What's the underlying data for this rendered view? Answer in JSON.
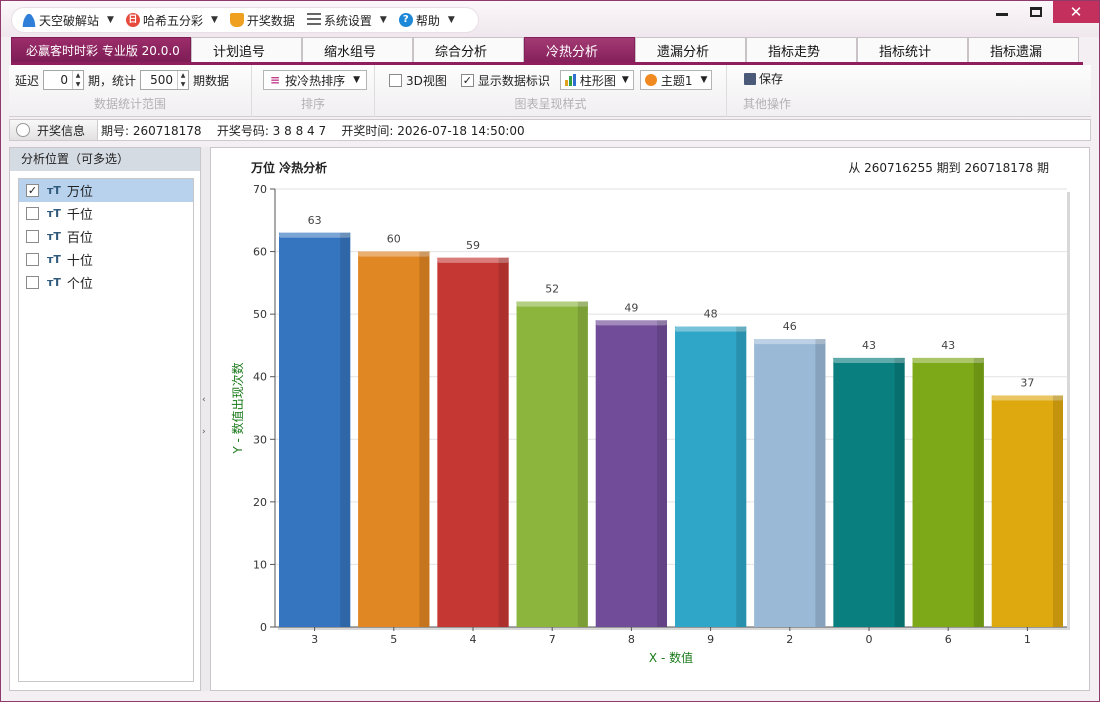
{
  "menu": {
    "items": [
      {
        "label": "天空破解站",
        "icon": "user-icon"
      },
      {
        "label": "哈希五分彩",
        "icon": "hash-icon"
      },
      {
        "label": "开奖数据",
        "icon": "trophy-icon"
      },
      {
        "label": "系统设置",
        "icon": "settings-icon"
      },
      {
        "label": "帮助",
        "icon": "help-icon"
      }
    ]
  },
  "window": {
    "close_symbol": "✕"
  },
  "tabs": {
    "brand": "必赢客时时彩 专业版 20.0.0",
    "items": [
      "计划追号",
      "缩水组号",
      "综合分析",
      "冷热分析",
      "遗漏分析",
      "指标走势",
      "指标统计",
      "指标遗漏"
    ],
    "active": "冷热分析"
  },
  "ribbon": {
    "delay_label": "延迟",
    "delay_value": "0",
    "period_label": "期，统计",
    "count_value": "500",
    "count_suffix": "期数据",
    "group1_label": "数据统计范围",
    "sort_button": "按冷热排序",
    "group2_label": "排序",
    "view3d_label": "3D视图",
    "view3d_checked": false,
    "show_labels_label": "显示数据标识",
    "show_labels_checked": true,
    "chart_type": "柱形图",
    "theme": "主题1",
    "group3_label": "图表呈现样式",
    "save_label": "保存",
    "group4_label": "其他操作"
  },
  "info": {
    "button_label": "开奖信息",
    "text": "期号: 260718178    开奖号码: 3 8 8 4 7    开奖时间: 2026-07-18 14:50:00"
  },
  "left_panel": {
    "title": "分析位置（可多选）",
    "items": [
      {
        "label": "万位",
        "checked": true
      },
      {
        "label": "千位",
        "checked": false
      },
      {
        "label": "百位",
        "checked": false
      },
      {
        "label": "十位",
        "checked": false
      },
      {
        "label": "个位",
        "checked": false
      }
    ]
  },
  "chart": {
    "title": "万位 冷热分析",
    "range_text": "从 260716255 期到 260718178 期"
  },
  "chart_data": {
    "type": "bar",
    "title": "万位 冷热分析",
    "xlabel": "X - 数值",
    "ylabel": "Y - 数值出现次数",
    "categories": [
      "3",
      "5",
      "4",
      "7",
      "8",
      "9",
      "2",
      "0",
      "6",
      "1"
    ],
    "values": [
      63,
      60,
      59,
      52,
      49,
      48,
      46,
      43,
      43,
      37
    ],
    "ylim": [
      0,
      70
    ],
    "yticks": [
      0,
      10,
      20,
      30,
      40,
      50,
      60,
      70
    ],
    "grid": true,
    "data_labels": true,
    "colors": [
      "#3a7fd0",
      "#f39225",
      "#d63c38",
      "#98c544",
      "#7b54a6",
      "#33b3d8",
      "#a7c9ea",
      "#0b8a8a",
      "#88b719",
      "#f1b711"
    ]
  }
}
